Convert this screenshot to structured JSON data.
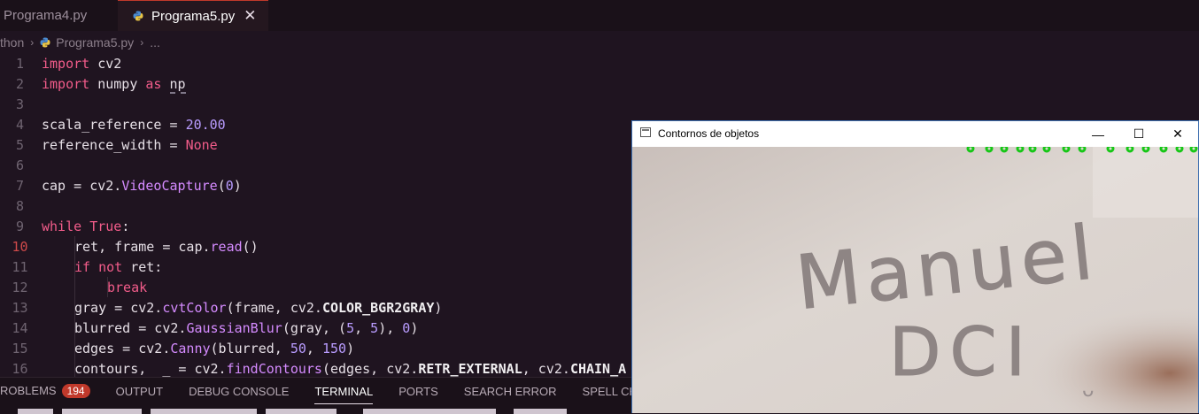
{
  "tabs": [
    {
      "label": "Programa4.py",
      "active": false
    },
    {
      "label": "Programa5.py",
      "active": true
    }
  ],
  "breadcrumb": {
    "root": "thon",
    "file": "Programa5.py",
    "more": "..."
  },
  "editor": {
    "active_line": "10",
    "lines": [
      {
        "n": "1"
      },
      {
        "n": "2"
      },
      {
        "n": "3"
      },
      {
        "n": "4"
      },
      {
        "n": "5"
      },
      {
        "n": "6"
      },
      {
        "n": "7"
      },
      {
        "n": "8"
      },
      {
        "n": "9"
      },
      {
        "n": "10"
      },
      {
        "n": "11"
      },
      {
        "n": "12"
      },
      {
        "n": "13"
      },
      {
        "n": "14"
      },
      {
        "n": "15"
      },
      {
        "n": "16"
      }
    ],
    "tokens": {
      "import": "import",
      "cv2": "cv2",
      "numpy": "numpy",
      "as": "as",
      "np": "np",
      "scala_ref": "scala_reference",
      "eq": " = ",
      "scala_val": "20.00",
      "ref_width": "reference_width",
      "none": "None",
      "cap": "cap",
      "cv2dot": "cv2.",
      "videocap": "VideoCapture",
      "zero": "0",
      "while": "while",
      "true": "True",
      "ret_frame": "ret, frame = cap.",
      "read": "read",
      "read_paren": "()",
      "if": "if",
      "not": "not",
      "ret": "ret:",
      "brk": "break",
      "gray_eq": "gray = cv2.",
      "cvtcolor": "cvtColor",
      "cvt_args": "(frame, cv2.",
      "bgr2gray": "COLOR_BGR2GRAY",
      "blur_eq": "blurred = cv2.",
      "gauss": "GaussianBlur",
      "gauss_a": "(gray, (",
      "five": "5",
      "comma": ", ",
      "edges_eq": "edges = cv2.",
      "canny": "Canny",
      "canny_a": "(blurred, ",
      "fifty": "50",
      "onefifty": "150",
      "cont_eq": "contours,  _ = cv2.",
      "findc": "findContours",
      "findc_a": "(edges, cv2.",
      "retr": "RETR_EXTERNAL",
      "chain": "CHAIN_A"
    }
  },
  "panel": {
    "tabs": [
      "ROBLEMS",
      "OUTPUT",
      "DEBUG CONSOLE",
      "TERMINAL",
      "PORTS",
      "SEARCH ERROR",
      "SPELL CHECKER"
    ],
    "problems_count": "194",
    "active_tab": "TERMINAL"
  },
  "window": {
    "title": "Contornos de objetos",
    "minimize": "—",
    "maximize": "☐",
    "close": "✕",
    "handwriting_line1": "Manuel",
    "handwriting_line2": "DCI",
    "handwriting_doodle": "ᴗ"
  }
}
